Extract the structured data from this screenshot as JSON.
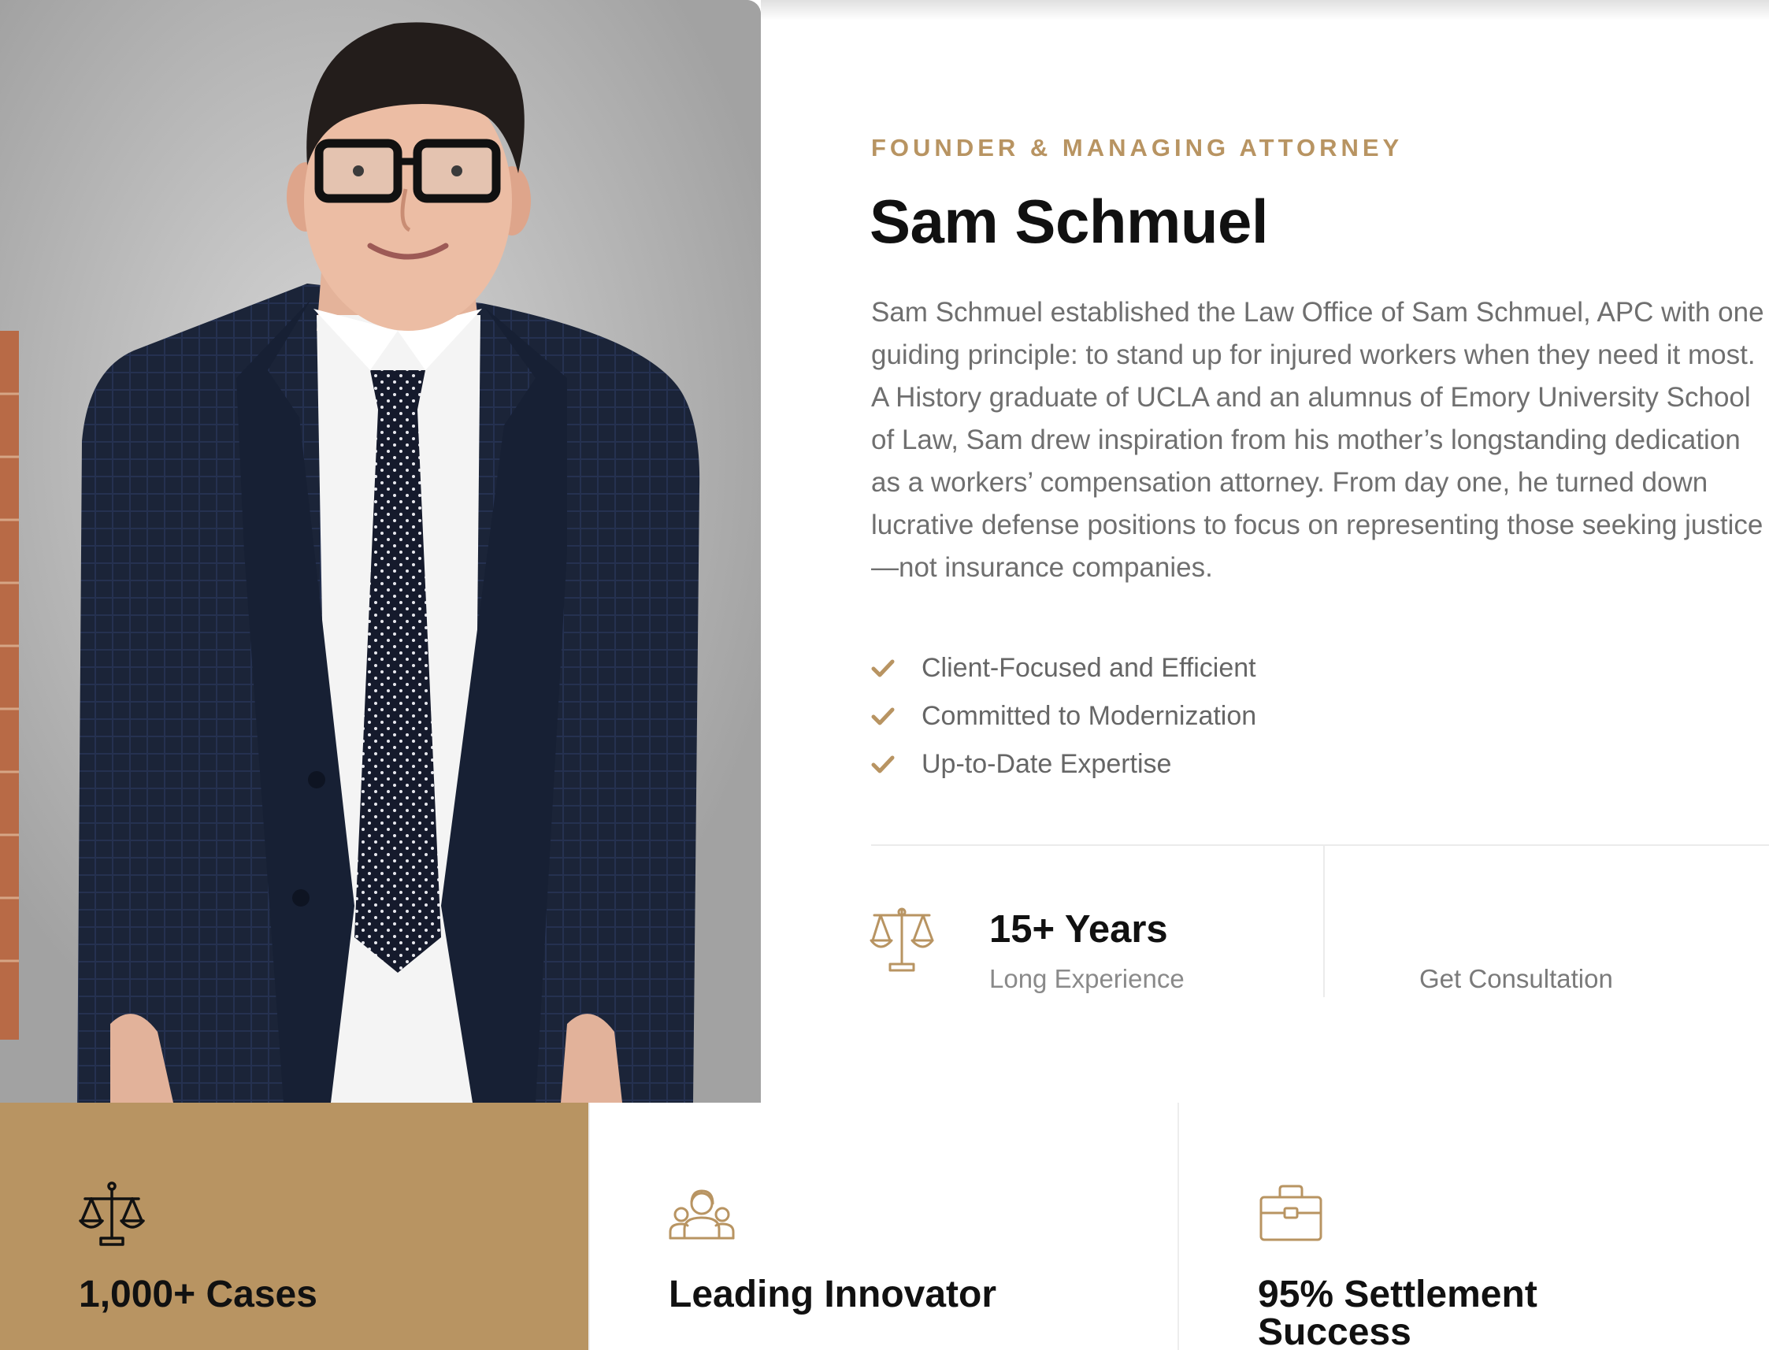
{
  "profile": {
    "eyebrow": "FOUNDER & MANAGING ATTORNEY",
    "name": "Sam Schmuel",
    "bio": "Sam Schmuel established the Law Office of Sam Schmuel, APC with one guiding principle: to stand up for injured workers when they need it most. A History graduate of UCLA and an alumnus of Emory University School of Law, Sam drew inspiration from his mother’s longstanding dedication as a workers’ compensation attorney. From day one, he turned down lucrative defense positions to focus on representing those seeking justice—not insurance companies.",
    "features": [
      {
        "label": "Client-Focused and Efficient",
        "icon": "check-icon"
      },
      {
        "label": "Committed to Modernization",
        "icon": "check-icon"
      },
      {
        "label": "Up-to-Date Expertise",
        "icon": "check-icon"
      }
    ]
  },
  "experience": {
    "icon": "scales-of-justice-icon",
    "number": "15+ Years",
    "label": "Long Experience",
    "cta_label": "Get Consultation"
  },
  "stats": [
    {
      "icon": "scales-of-justice-icon",
      "title": "1,000+ Cases",
      "highlighted": true
    },
    {
      "icon": "team-people-icon",
      "title": "Leading Innovator",
      "highlighted": false
    },
    {
      "icon": "briefcase-icon",
      "title": "95% Settlement Success",
      "highlighted": false
    }
  ],
  "colors": {
    "accent": "#b89462",
    "heading": "#111111",
    "body_text": "#6f6f6f",
    "divider": "#ebebeb"
  }
}
